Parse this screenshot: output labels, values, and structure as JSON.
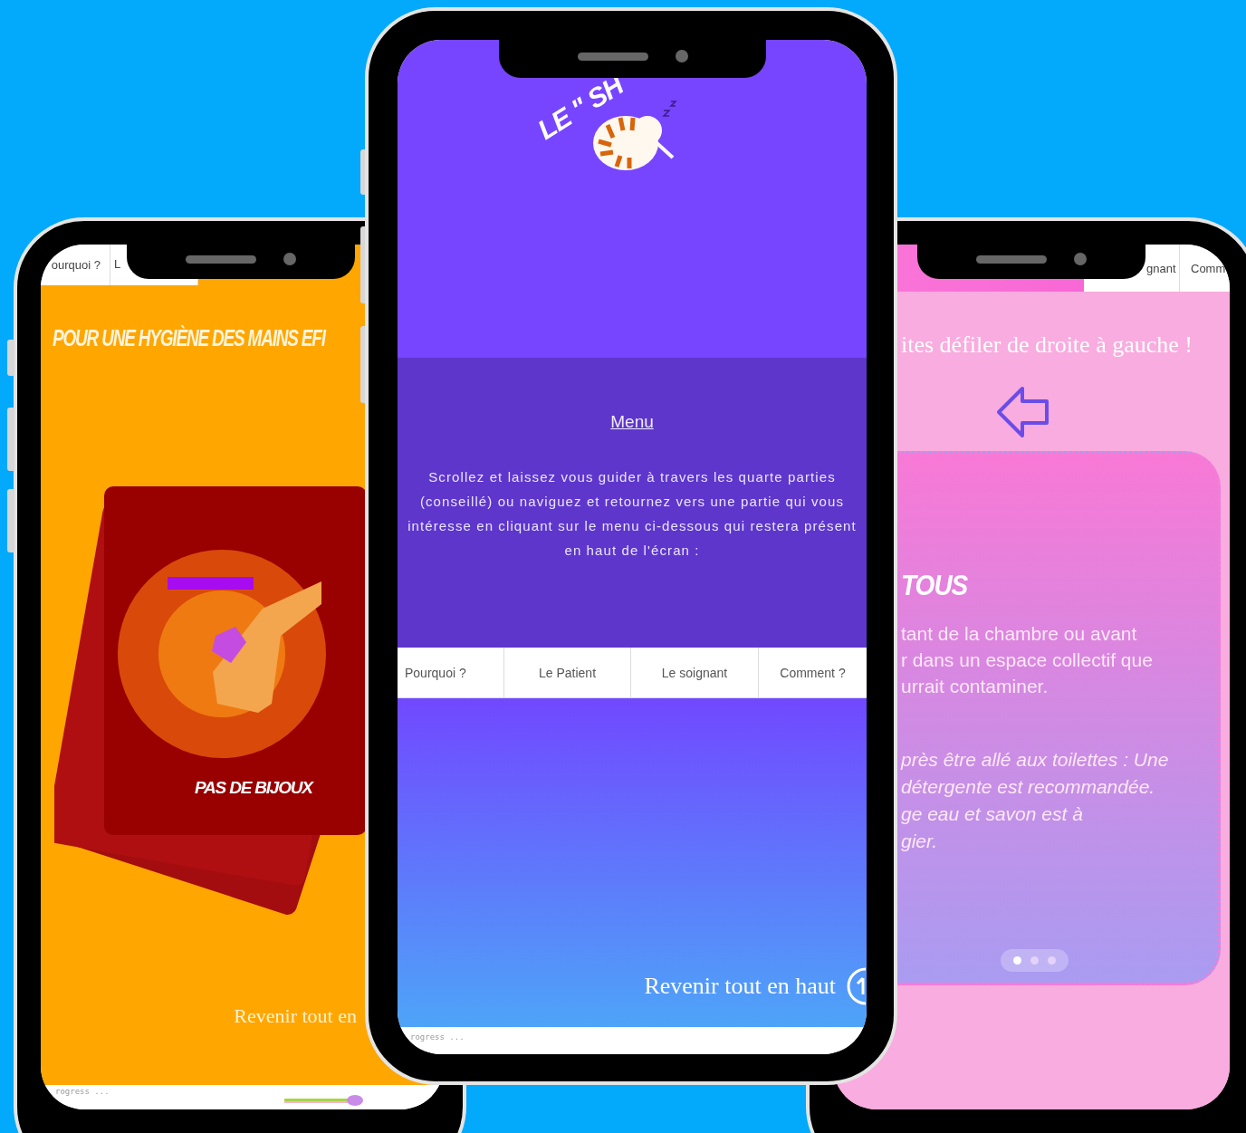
{
  "left_phone": {
    "nav_tabs": [
      {
        "label": "ourquoi ?",
        "selected": false
      },
      {
        "label": "L",
        "selected": false
      }
    ],
    "title": "POUR UNE HYGIÈNE DES MAINS EFI",
    "card_label": "PAS DE BIJOUX",
    "back_to_top": "Revenir tout en",
    "progress_label": "rogress ..."
  },
  "center_phone": {
    "logo": "LE \" SH",
    "menu_title": "Menu",
    "intro": "Scrollez et laissez vous guider à travers les quarte parties (conseillé) ou naviguez et retournez vers une partie qui vous intéresse en cliquant sur le menu ci-dessous qui restera présent en haut de l'écran :",
    "nav_tabs": [
      {
        "label": "Pourquoi ?",
        "selected": false
      },
      {
        "label": "Le Patient",
        "selected": false
      },
      {
        "label": "Le soignant",
        "selected": false
      },
      {
        "label": "Comment ?",
        "selected": false
      }
    ],
    "back_to_top": "Revenir tout en haut",
    "progress_label": "rogress ..."
  },
  "right_phone": {
    "nav_tabs": [
      {
        "label": "gnant",
        "selected": false
      },
      {
        "label": "Comm",
        "selected": false
      }
    ],
    "hint": "ites défiler de droite à gauche !",
    "card": {
      "title": "TOUS",
      "paragraphs": [
        {
          "kind": "plain",
          "text": "tant de la chambre ou avant\nr dans un espace collectif que\nurrait contaminer."
        },
        {
          "kind": "italic",
          "text": "près être allé aux toilettes : Une\ndétergente est recommandée.\nge eau et savon est à\ngier."
        }
      ]
    },
    "dots": [
      {
        "selected": true
      },
      {
        "selected": false
      },
      {
        "selected": false
      }
    ]
  }
}
